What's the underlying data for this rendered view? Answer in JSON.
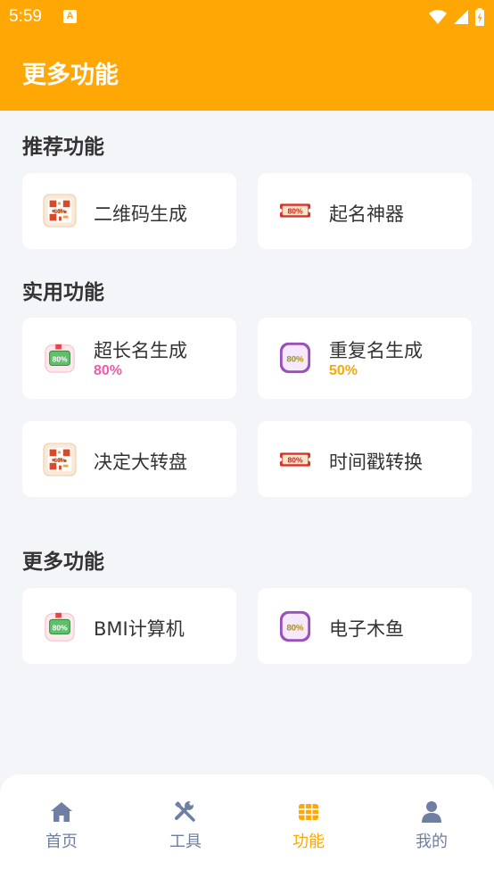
{
  "status_bar": {
    "time": "5:59",
    "notification_glyph": "A"
  },
  "header": {
    "title": "更多功能"
  },
  "colors": {
    "accent": "#ffa704",
    "tab_inactive": "#6f7fa3",
    "pink": "#f05aa6",
    "orange": "#f7a90b"
  },
  "sections": [
    {
      "title": "推荐功能",
      "cards": [
        {
          "label": "二维码生成",
          "icon": "qr-badge-icon"
        },
        {
          "label": "起名神器",
          "icon": "ticket-80-icon"
        }
      ]
    },
    {
      "title": "实用功能",
      "cards": [
        {
          "label": "超长名生成",
          "percent": "80%",
          "icon": "flag-80-icon"
        },
        {
          "label": "重复名生成",
          "percent": "50%",
          "icon": "purple-80-icon"
        },
        {
          "label": "决定大转盘",
          "icon": "qr-badge-icon"
        },
        {
          "label": "时间戳转换",
          "icon": "ticket-80-icon"
        }
      ]
    },
    {
      "title": "更多功能",
      "cards": [
        {
          "label": "BMI计算机",
          "icon": "flag-80-icon"
        },
        {
          "label": "电子木鱼",
          "icon": "purple-80-icon"
        }
      ]
    }
  ],
  "tabs": [
    {
      "label": "首页",
      "icon": "home-icon",
      "active": false
    },
    {
      "label": "工具",
      "icon": "tools-icon",
      "active": false
    },
    {
      "label": "功能",
      "icon": "grid-icon",
      "active": true
    },
    {
      "label": "我的",
      "icon": "user-icon",
      "active": false
    }
  ]
}
